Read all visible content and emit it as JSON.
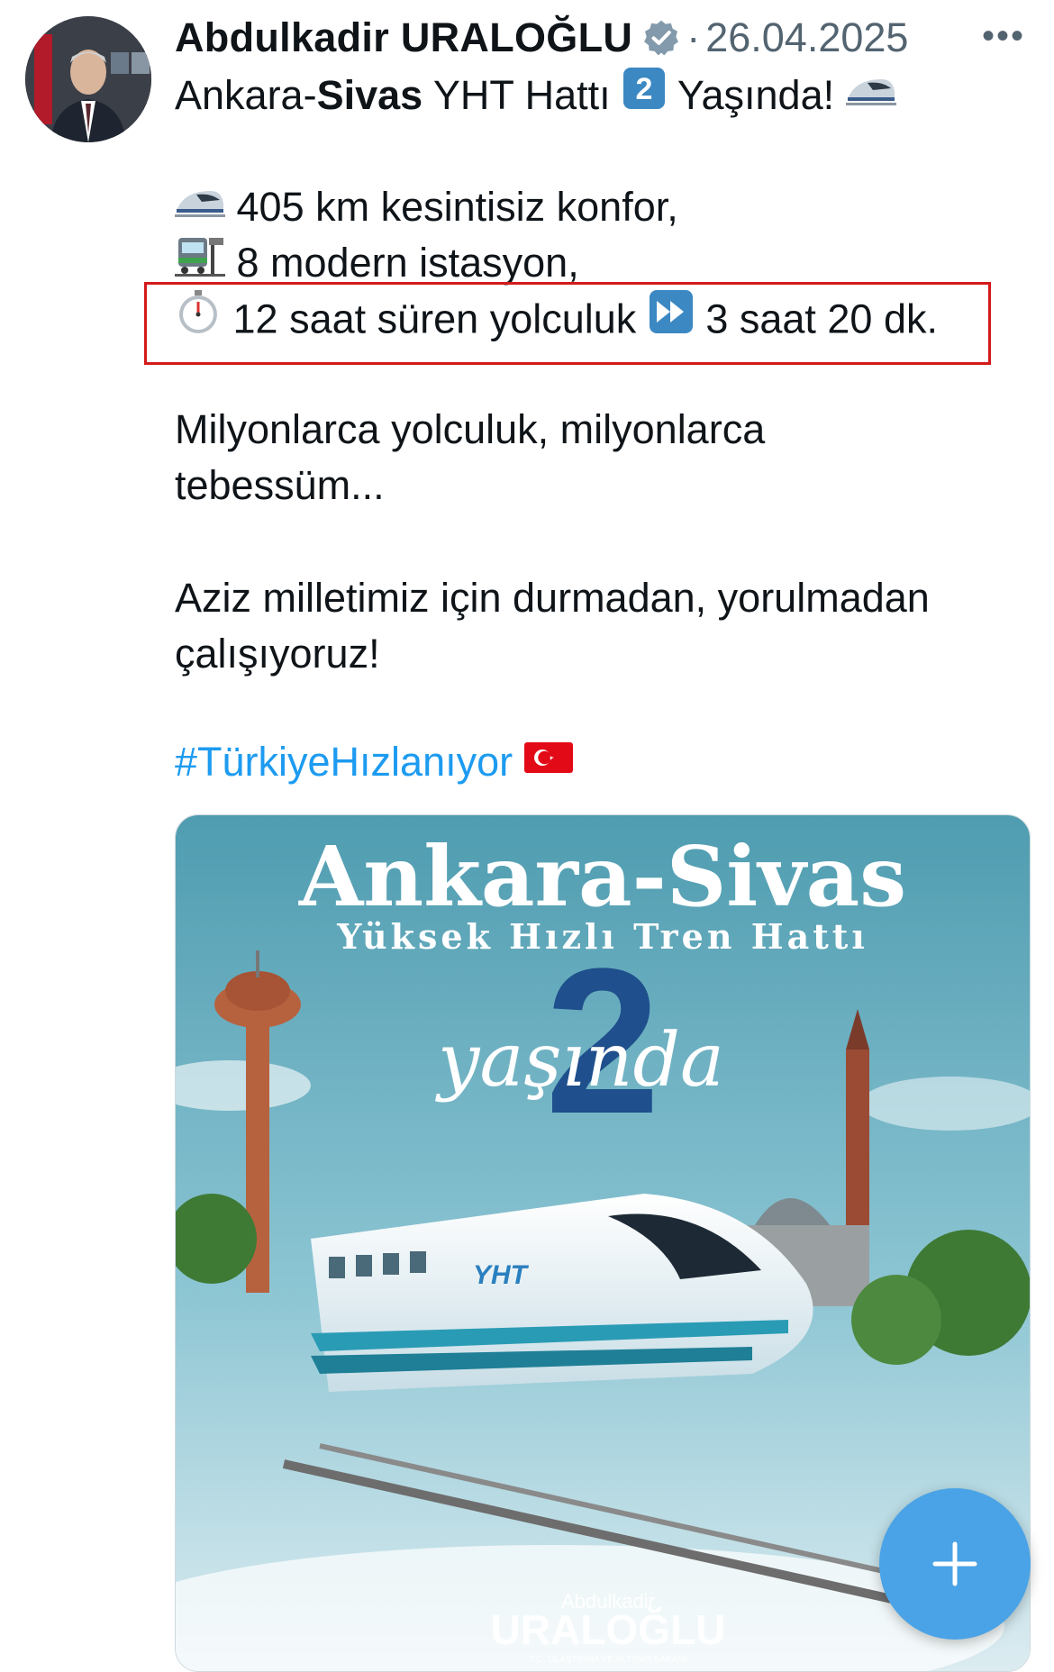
{
  "post": {
    "author_name": "Abdulkadir URALOĞLU",
    "separator": "·",
    "date": "26.04.2025",
    "more_label": "•••",
    "title": {
      "part1": "Ankara-",
      "bold": "Sivas",
      "part2": " YHT Hattı",
      "keycap": "2",
      "part3": "Yaşında!"
    },
    "lines": [
      "405 km kesintisiz konfor,",
      "8 modern istasyon,"
    ],
    "time_line": {
      "before": "12 saat süren yolculuk",
      "after": "3 saat 20 dk."
    },
    "paragraph1": [
      "Milyonlarca yolculuk, milyonlarca",
      "tebessüm..."
    ],
    "paragraph2": [
      "Aziz milletimiz için durmadan, yorulmadan",
      "çalışıyoruz!"
    ],
    "hashtag": "#TürkiyeHızlanıyor"
  },
  "media": {
    "title": "Ankara-Sivas",
    "subtitle": "Yüksek Hızlı Tren Hattı",
    "number": "2",
    "script_text": "yaşında",
    "train_label": "YHT",
    "logo_top": "Abdulkadir",
    "logo_main": "URALOĞLU",
    "logo_sub": "T.C. ULAŞTIRMA VE ALTYAPI BAKANI"
  },
  "icons": {
    "verified": "verified-badge-icon",
    "train": "high-speed-train-icon",
    "station": "tram-station-icon",
    "stopwatch": "stopwatch-icon",
    "fast_forward": "fast-forward-icon",
    "flag": "turkey-flag-icon",
    "compose": "plus-icon"
  },
  "colors": {
    "link": "#1d9bf0",
    "highlight_box": "#d41a1a",
    "fab": "#4aa3e6",
    "verified": "#829aab"
  }
}
